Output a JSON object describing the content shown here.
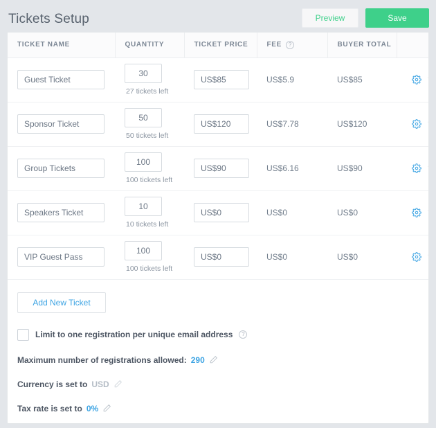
{
  "header": {
    "title": "Tickets Setup",
    "preview_label": "Preview",
    "save_label": "Save"
  },
  "table": {
    "columns": [
      {
        "label": "TICKET NAME"
      },
      {
        "label": "QUANTITY"
      },
      {
        "label": "TICKET PRICE"
      },
      {
        "label": "FEE",
        "help": "?"
      },
      {
        "label": "BUYER TOTAL"
      },
      {
        "label": ""
      }
    ],
    "rows": [
      {
        "name": "Guest Ticket",
        "quantity": "30",
        "tickets_left": "27 tickets left",
        "price": "US$85",
        "fee": "US$5.9",
        "buyer_total": "US$85"
      },
      {
        "name": "Sponsor Ticket",
        "quantity": "50",
        "tickets_left": "50 tickets left",
        "price": "US$120",
        "fee": "US$7.78",
        "buyer_total": "US$120"
      },
      {
        "name": "Group Tickets",
        "quantity": "100",
        "tickets_left": "100 tickets left",
        "price": "US$90",
        "fee": "US$6.16",
        "buyer_total": "US$90"
      },
      {
        "name": "Speakers Ticket",
        "quantity": "10",
        "tickets_left": "10 tickets left",
        "price": "US$0",
        "fee": "US$0",
        "buyer_total": "US$0"
      },
      {
        "name": "VIP Guest Pass",
        "quantity": "100",
        "tickets_left": "100 tickets left",
        "price": "US$0",
        "fee": "US$0",
        "buyer_total": "US$0"
      }
    ]
  },
  "footer": {
    "add_ticket_label": "Add New Ticket",
    "limit_label": "Limit to one registration per unique email address",
    "limit_help": "?",
    "limit_checked": false,
    "max_registrations_label": "Maximum number of registrations allowed:",
    "max_registrations_value": "290",
    "currency_label": "Currency is set to",
    "currency_value": "USD",
    "tax_label": "Tax rate is set to",
    "tax_value": "0%"
  },
  "colors": {
    "accent_green": "#3ed08a",
    "accent_blue": "#3ba3e3",
    "page_bg": "#e3e6ea",
    "muted_text": "#8b95a1"
  }
}
